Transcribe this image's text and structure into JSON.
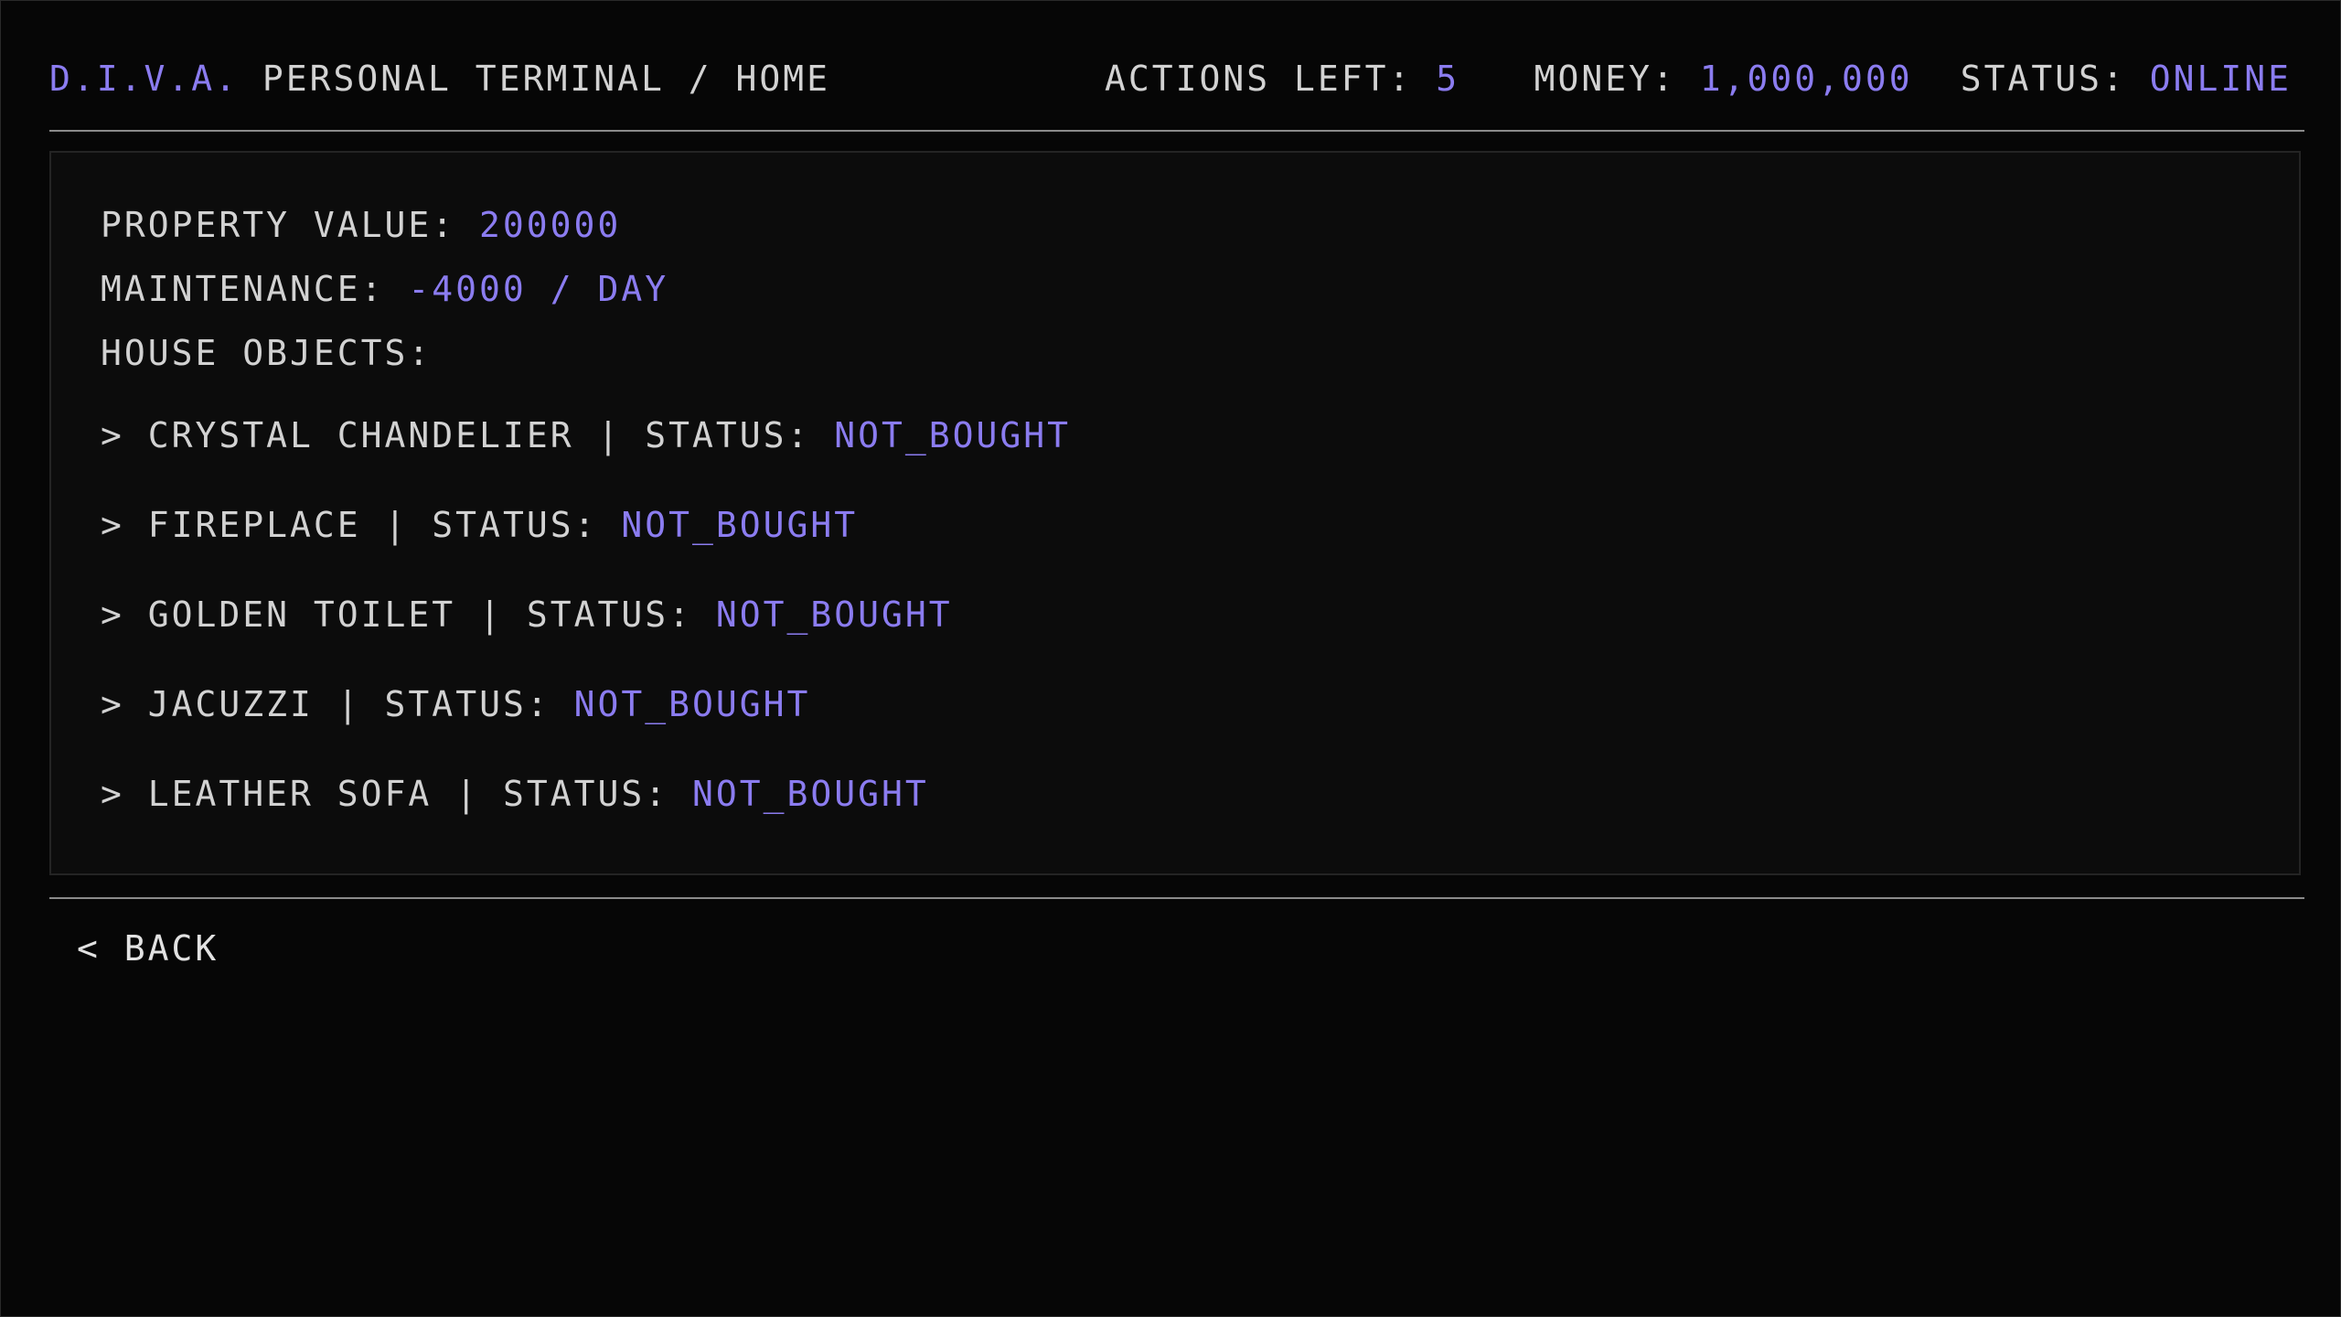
{
  "header": {
    "brand": "D.I.V.A.",
    "path": " PERSONAL TERMINAL / HOME",
    "actions_label": "ACTIONS LEFT: ",
    "actions_value": "5",
    "money_label": "MONEY: ",
    "money_value": "1,000,000",
    "status_label": "STATUS: ",
    "status_value": "ONLINE"
  },
  "property": {
    "value_label": "PROPERTY VALUE: ",
    "value": "200000",
    "maintenance_label": "MAINTENANCE: ",
    "maintenance_value": "-4000 / DAY",
    "objects_label": "HOUSE OBJECTS:",
    "objects": [
      {
        "prefix": "> ",
        "name": "CRYSTAL CHANDELIER",
        "status_label": " | STATUS: ",
        "status": "NOT_BOUGHT"
      },
      {
        "prefix": "> ",
        "name": "FIREPLACE",
        "status_label": " | STATUS: ",
        "status": "NOT_BOUGHT"
      },
      {
        "prefix": "> ",
        "name": "GOLDEN TOILET",
        "status_label": " | STATUS: ",
        "status": "NOT_BOUGHT"
      },
      {
        "prefix": "> ",
        "name": "JACUZZI",
        "status_label": " | STATUS: ",
        "status": "NOT_BOUGHT"
      },
      {
        "prefix": "> ",
        "name": "LEATHER SOFA",
        "status_label": " | STATUS: ",
        "status": "NOT_BOUGHT"
      }
    ]
  },
  "footer": {
    "back_label": "< BACK"
  },
  "colors": {
    "accent": "#8b7cf0",
    "text": "#d2d2d2",
    "background": "#060606",
    "panel": "#0c0c0c"
  }
}
